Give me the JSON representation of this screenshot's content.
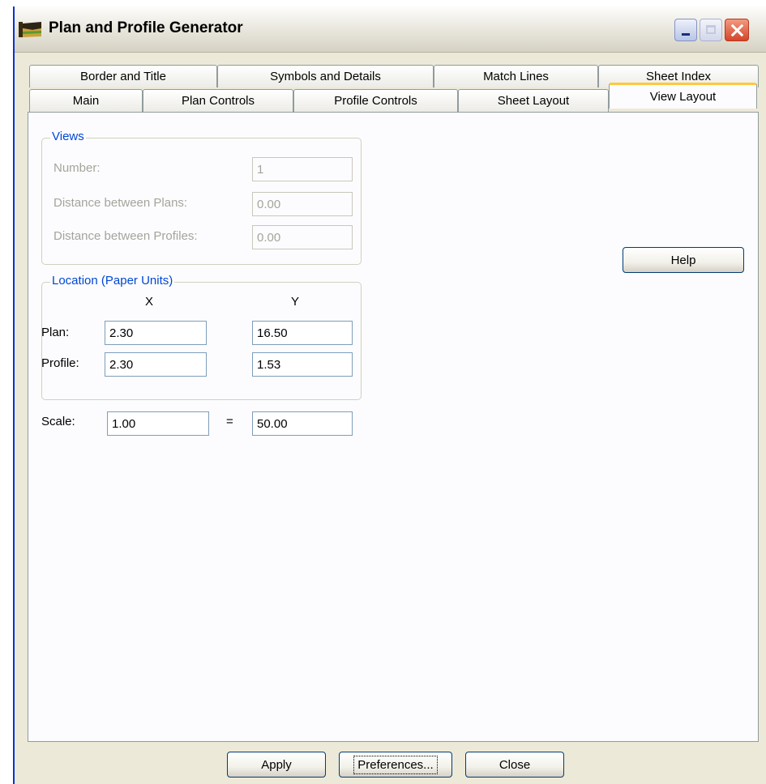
{
  "window": {
    "title": "Plan and Profile Generator"
  },
  "tabs_row1": [
    "Border and Title",
    "Symbols and Details",
    "Match Lines",
    "Sheet Index"
  ],
  "tabs_row2": [
    "Main",
    "Plan Controls",
    "Profile Controls",
    "Sheet Layout",
    "View Layout"
  ],
  "active_tab": "View Layout",
  "views": {
    "title": "Views",
    "number_label": "Number:",
    "number_value": "1",
    "plans_label": "Distance between Plans:",
    "plans_value": "0.00",
    "profiles_label": "Distance between Profiles:",
    "profiles_value": "0.00"
  },
  "location": {
    "title": "Location (Paper Units)",
    "x_header": "X",
    "y_header": "Y",
    "plan_label": "Plan:",
    "plan_x": "2.30",
    "plan_y": "16.50",
    "profile_label": "Profile:",
    "profile_x": "2.30",
    "profile_y": "1.53"
  },
  "scale": {
    "label": "Scale:",
    "left": "1.00",
    "equals": "=",
    "right": "50.00"
  },
  "buttons": {
    "help": "Help",
    "apply": "Apply",
    "preferences": "Preferences...",
    "close": "Close"
  }
}
